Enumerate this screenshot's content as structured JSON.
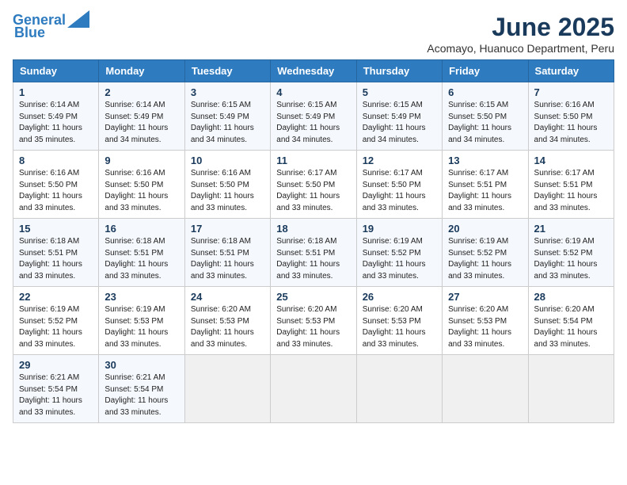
{
  "logo": {
    "line1": "General",
    "line2": "Blue"
  },
  "title": "June 2025",
  "location": "Acomayo, Huanuco Department, Peru",
  "headers": [
    "Sunday",
    "Monday",
    "Tuesday",
    "Wednesday",
    "Thursday",
    "Friday",
    "Saturday"
  ],
  "weeks": [
    [
      {
        "day": 1,
        "sunrise": "6:14 AM",
        "sunset": "5:49 PM",
        "daylight": "11 hours and 35 minutes."
      },
      {
        "day": 2,
        "sunrise": "6:14 AM",
        "sunset": "5:49 PM",
        "daylight": "11 hours and 34 minutes."
      },
      {
        "day": 3,
        "sunrise": "6:15 AM",
        "sunset": "5:49 PM",
        "daylight": "11 hours and 34 minutes."
      },
      {
        "day": 4,
        "sunrise": "6:15 AM",
        "sunset": "5:49 PM",
        "daylight": "11 hours and 34 minutes."
      },
      {
        "day": 5,
        "sunrise": "6:15 AM",
        "sunset": "5:49 PM",
        "daylight": "11 hours and 34 minutes."
      },
      {
        "day": 6,
        "sunrise": "6:15 AM",
        "sunset": "5:50 PM",
        "daylight": "11 hours and 34 minutes."
      },
      {
        "day": 7,
        "sunrise": "6:16 AM",
        "sunset": "5:50 PM",
        "daylight": "11 hours and 34 minutes."
      }
    ],
    [
      {
        "day": 8,
        "sunrise": "6:16 AM",
        "sunset": "5:50 PM",
        "daylight": "11 hours and 33 minutes."
      },
      {
        "day": 9,
        "sunrise": "6:16 AM",
        "sunset": "5:50 PM",
        "daylight": "11 hours and 33 minutes."
      },
      {
        "day": 10,
        "sunrise": "6:16 AM",
        "sunset": "5:50 PM",
        "daylight": "11 hours and 33 minutes."
      },
      {
        "day": 11,
        "sunrise": "6:17 AM",
        "sunset": "5:50 PM",
        "daylight": "11 hours and 33 minutes."
      },
      {
        "day": 12,
        "sunrise": "6:17 AM",
        "sunset": "5:50 PM",
        "daylight": "11 hours and 33 minutes."
      },
      {
        "day": 13,
        "sunrise": "6:17 AM",
        "sunset": "5:51 PM",
        "daylight": "11 hours and 33 minutes."
      },
      {
        "day": 14,
        "sunrise": "6:17 AM",
        "sunset": "5:51 PM",
        "daylight": "11 hours and 33 minutes."
      }
    ],
    [
      {
        "day": 15,
        "sunrise": "6:18 AM",
        "sunset": "5:51 PM",
        "daylight": "11 hours and 33 minutes."
      },
      {
        "day": 16,
        "sunrise": "6:18 AM",
        "sunset": "5:51 PM",
        "daylight": "11 hours and 33 minutes."
      },
      {
        "day": 17,
        "sunrise": "6:18 AM",
        "sunset": "5:51 PM",
        "daylight": "11 hours and 33 minutes."
      },
      {
        "day": 18,
        "sunrise": "6:18 AM",
        "sunset": "5:51 PM",
        "daylight": "11 hours and 33 minutes."
      },
      {
        "day": 19,
        "sunrise": "6:19 AM",
        "sunset": "5:52 PM",
        "daylight": "11 hours and 33 minutes."
      },
      {
        "day": 20,
        "sunrise": "6:19 AM",
        "sunset": "5:52 PM",
        "daylight": "11 hours and 33 minutes."
      },
      {
        "day": 21,
        "sunrise": "6:19 AM",
        "sunset": "5:52 PM",
        "daylight": "11 hours and 33 minutes."
      }
    ],
    [
      {
        "day": 22,
        "sunrise": "6:19 AM",
        "sunset": "5:52 PM",
        "daylight": "11 hours and 33 minutes."
      },
      {
        "day": 23,
        "sunrise": "6:19 AM",
        "sunset": "5:53 PM",
        "daylight": "11 hours and 33 minutes."
      },
      {
        "day": 24,
        "sunrise": "6:20 AM",
        "sunset": "5:53 PM",
        "daylight": "11 hours and 33 minutes."
      },
      {
        "day": 25,
        "sunrise": "6:20 AM",
        "sunset": "5:53 PM",
        "daylight": "11 hours and 33 minutes."
      },
      {
        "day": 26,
        "sunrise": "6:20 AM",
        "sunset": "5:53 PM",
        "daylight": "11 hours and 33 minutes."
      },
      {
        "day": 27,
        "sunrise": "6:20 AM",
        "sunset": "5:53 PM",
        "daylight": "11 hours and 33 minutes."
      },
      {
        "day": 28,
        "sunrise": "6:20 AM",
        "sunset": "5:54 PM",
        "daylight": "11 hours and 33 minutes."
      }
    ],
    [
      {
        "day": 29,
        "sunrise": "6:21 AM",
        "sunset": "5:54 PM",
        "daylight": "11 hours and 33 minutes."
      },
      {
        "day": 30,
        "sunrise": "6:21 AM",
        "sunset": "5:54 PM",
        "daylight": "11 hours and 33 minutes."
      },
      null,
      null,
      null,
      null,
      null
    ]
  ]
}
